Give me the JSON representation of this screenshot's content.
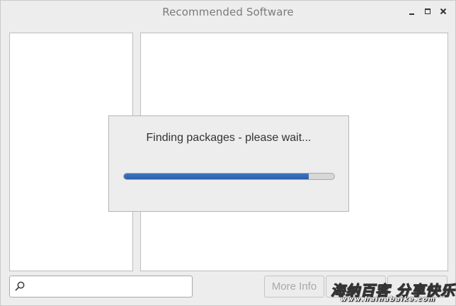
{
  "window": {
    "title": "Recommended Software",
    "controls": [
      "minimize-icon",
      "maximize-icon",
      "close-icon"
    ]
  },
  "search": {
    "value": "",
    "placeholder": "",
    "icon": "search-icon"
  },
  "buttons": {
    "more_info": "More Info",
    "button_2": "",
    "button_3": ""
  },
  "dialog": {
    "message": "Finding packages - please wait...",
    "progress": 0.88,
    "progress_color": "#3566b5"
  },
  "watermark": {
    "text": "海纳百客 分享快乐",
    "subtext": "www.hainabaike.com"
  }
}
